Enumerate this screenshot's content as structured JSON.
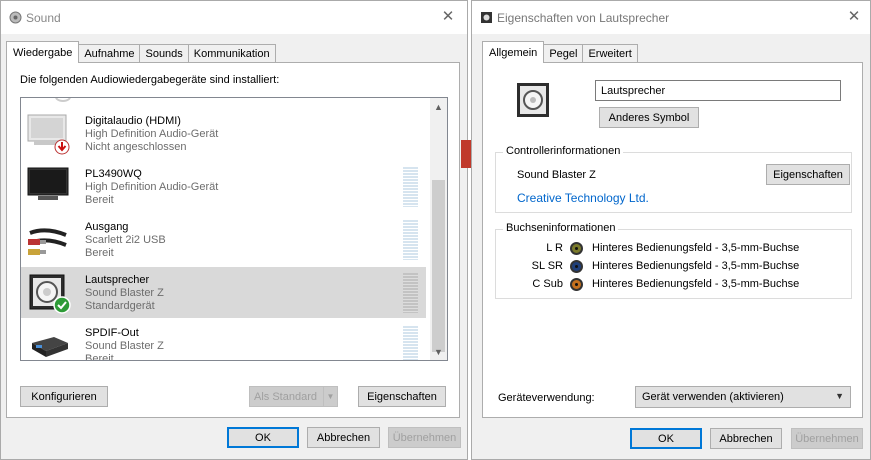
{
  "sound": {
    "title": "Sound",
    "tabs": [
      "Wiedergabe",
      "Aufnahme",
      "Sounds",
      "Kommunikation"
    ],
    "heading": "Die folgenden Audiowiedergabegeräte sind installiert:",
    "devices": [
      {
        "name": "Digitalaudio (HDMI)",
        "line1": "High Definition Audio-Gerät",
        "line2": "Nicht angeschlossen",
        "icon": "monitor-disconnected-icon",
        "meter_level": 0
      },
      {
        "name": "PL3490WQ",
        "line1": "High Definition Audio-Gerät",
        "line2": "Bereit",
        "icon": "monitor-icon",
        "meter_level": 0
      },
      {
        "name": "Ausgang",
        "line1": "Scarlett 2i2 USB",
        "line2": "Bereit",
        "icon": "rca-cable-icon",
        "meter_level": 0
      },
      {
        "name": "Lautsprecher",
        "line1": "Sound Blaster Z",
        "line2": "Standardgerät",
        "icon": "speaker-default-icon",
        "meter_level": 0
      },
      {
        "name": "SPDIF-Out",
        "line1": "Sound Blaster Z",
        "line2": "Bereit",
        "icon": "spdif-icon",
        "meter_level": 0
      }
    ],
    "buttons": {
      "configure": "Konfigurieren",
      "set_default": "Als Standard",
      "properties": "Eigenschaften",
      "ok": "OK",
      "cancel": "Abbrechen",
      "apply": "Übernehmen"
    }
  },
  "props": {
    "title": "Eigenschaften von Lautsprecher",
    "tabs": [
      "Allgemein",
      "Pegel",
      "Erweitert"
    ],
    "device_name": "Lautsprecher",
    "change_icon": "Anderes Symbol",
    "controller_group": "Controllerinformationen",
    "controller_name": "Sound Blaster Z",
    "controller_props_button": "Eigenschaften",
    "vendor_link": "Creative Technology Ltd.",
    "jack_group": "Buchseninformationen",
    "jacks": [
      {
        "channel": "L R",
        "desc": "Hinteres Bedienungsfeld - 3,5-mm-Buchse",
        "color": "#7a7a2a"
      },
      {
        "channel": "SL SR",
        "desc": "Hinteres Bedienungsfeld - 3,5-mm-Buchse",
        "color": "#1f3f7a"
      },
      {
        "channel": "C Sub",
        "desc": "Hinteres Bedienungsfeld - 3,5-mm-Buchse",
        "color": "#c4701e"
      }
    ],
    "usage_label": "Geräteverwendung:",
    "usage_value": "Gerät verwenden (aktivieren)",
    "buttons": {
      "ok": "OK",
      "cancel": "Abbrechen",
      "apply": "Übernehmen"
    }
  },
  "colors": {
    "link": "#0066cc",
    "selection": "#d9d9d9",
    "focus": "#0078d7"
  }
}
